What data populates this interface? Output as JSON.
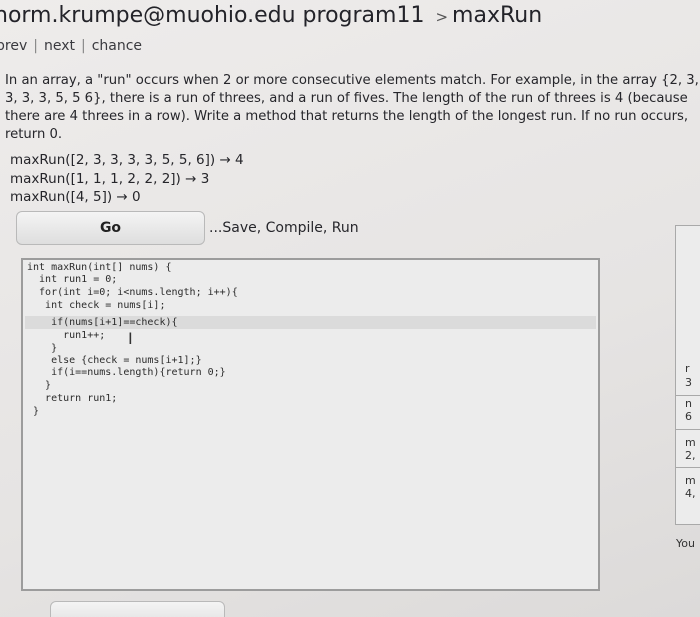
{
  "header": {
    "user": "norm.krumpe@muohio.edu",
    "problem_set": "program11",
    "separator": ">",
    "problem": "maxRun"
  },
  "nav": {
    "prev": "prev",
    "next": "next",
    "chance": "chance",
    "divider": "|"
  },
  "description": {
    "line1": "In an array, a \"run\" occurs when 2 or more consecutive elements match. For example, in the array {2, 3,",
    "line2": "3, 3, 3, 5, 5 6}, there is a run of threes, and a run of fives. The length of the run of threes is 4 (because",
    "line3": "there are 4 threes in a row). Write a method that returns the length of the longest run. If no run occurs,",
    "line4": "return 0."
  },
  "examples": [
    "maxRun([2, 3, 3, 3, 3, 5, 5, 6]) → 4",
    "maxRun([1, 1, 1, 2, 2, 2]) → 3",
    "maxRun([4, 5]) → 0"
  ],
  "toolbar": {
    "go_label": "Go",
    "save_hint": "...Save, Compile, Run"
  },
  "code": [
    "int maxRun(int[] nums) {",
    "  int run1 = 0;",
    "  for(int i=0; i<nums.length; i++){",
    "   int check = nums[i];",
    "    if(nums[i+1]==check){",
    "      run1++;",
    "    }",
    "    else {check = nums[i+1];}",
    "    if(i==nums.length){return 0;}",
    "   }",
    "   return run1;",
    " }"
  ],
  "right_panel": {
    "frag1": "r",
    "frag2": "3",
    "frag3": "n",
    "frag4": "6",
    "frag5": "m",
    "frag6": "2,",
    "frag7": "m",
    "frag8": "4,",
    "you": "You"
  },
  "colors": {
    "background": "#e9e7e6",
    "editor_bg": "#ececec",
    "ok_green": "#2f8b2f",
    "fail_red": "#b83030"
  }
}
